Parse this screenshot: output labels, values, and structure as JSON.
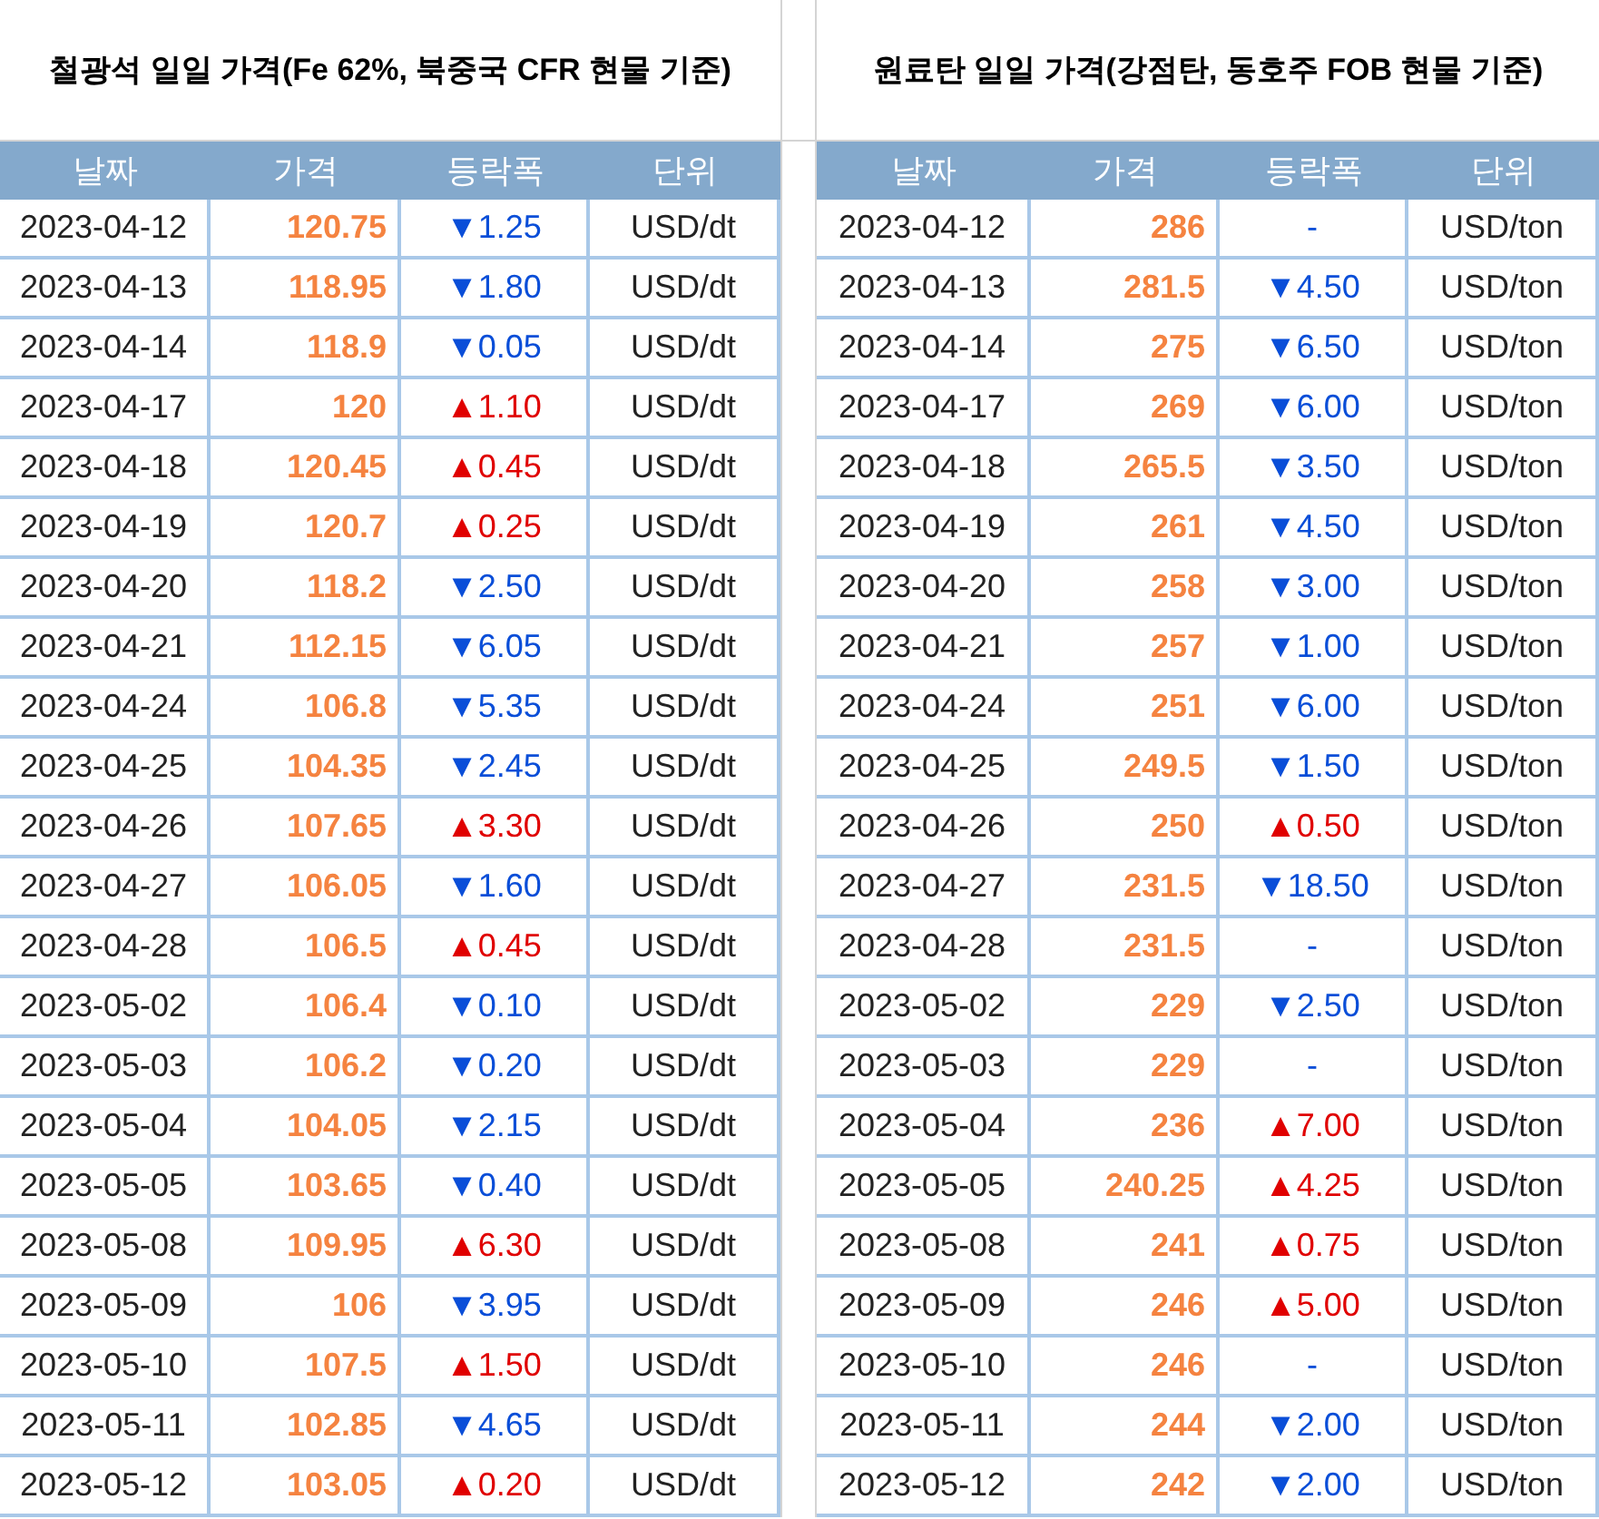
{
  "tables": [
    {
      "title": "철광석 일일 가격(Fe 62%, 북중국 CFR 현물 기준)",
      "columns": [
        "날짜",
        "가격",
        "등락폭",
        "단위"
      ],
      "rows": [
        {
          "date": "2023-04-12",
          "price": "120.75",
          "change": "▼1.25",
          "kind": "down",
          "unit": "USD/dt"
        },
        {
          "date": "2023-04-13",
          "price": "118.95",
          "change": "▼1.80",
          "kind": "down",
          "unit": "USD/dt"
        },
        {
          "date": "2023-04-14",
          "price": "118.9",
          "change": "▼0.05",
          "kind": "down",
          "unit": "USD/dt"
        },
        {
          "date": "2023-04-17",
          "price": "120",
          "change": "▲1.10",
          "kind": "up",
          "unit": "USD/dt"
        },
        {
          "date": "2023-04-18",
          "price": "120.45",
          "change": "▲0.45",
          "kind": "up",
          "unit": "USD/dt"
        },
        {
          "date": "2023-04-19",
          "price": "120.7",
          "change": "▲0.25",
          "kind": "up",
          "unit": "USD/dt"
        },
        {
          "date": "2023-04-20",
          "price": "118.2",
          "change": "▼2.50",
          "kind": "down",
          "unit": "USD/dt"
        },
        {
          "date": "2023-04-21",
          "price": "112.15",
          "change": "▼6.05",
          "kind": "down",
          "unit": "USD/dt"
        },
        {
          "date": "2023-04-24",
          "price": "106.8",
          "change": "▼5.35",
          "kind": "down",
          "unit": "USD/dt"
        },
        {
          "date": "2023-04-25",
          "price": "104.35",
          "change": "▼2.45",
          "kind": "down",
          "unit": "USD/dt"
        },
        {
          "date": "2023-04-26",
          "price": "107.65",
          "change": "▲3.30",
          "kind": "up",
          "unit": "USD/dt"
        },
        {
          "date": "2023-04-27",
          "price": "106.05",
          "change": "▼1.60",
          "kind": "down",
          "unit": "USD/dt"
        },
        {
          "date": "2023-04-28",
          "price": "106.5",
          "change": "▲0.45",
          "kind": "up",
          "unit": "USD/dt"
        },
        {
          "date": "2023-05-02",
          "price": "106.4",
          "change": "▼0.10",
          "kind": "down",
          "unit": "USD/dt"
        },
        {
          "date": "2023-05-03",
          "price": "106.2",
          "change": "▼0.20",
          "kind": "down",
          "unit": "USD/dt"
        },
        {
          "date": "2023-05-04",
          "price": "104.05",
          "change": "▼2.15",
          "kind": "down",
          "unit": "USD/dt"
        },
        {
          "date": "2023-05-05",
          "price": "103.65",
          "change": "▼0.40",
          "kind": "down",
          "unit": "USD/dt"
        },
        {
          "date": "2023-05-08",
          "price": "109.95",
          "change": "▲6.30",
          "kind": "up",
          "unit": "USD/dt"
        },
        {
          "date": "2023-05-09",
          "price": "106",
          "change": "▼3.95",
          "kind": "down",
          "unit": "USD/dt"
        },
        {
          "date": "2023-05-10",
          "price": "107.5",
          "change": "▲1.50",
          "kind": "up",
          "unit": "USD/dt"
        },
        {
          "date": "2023-05-11",
          "price": "102.85",
          "change": "▼4.65",
          "kind": "down",
          "unit": "USD/dt"
        },
        {
          "date": "2023-05-12",
          "price": "103.05",
          "change": "▲0.20",
          "kind": "up",
          "unit": "USD/dt"
        }
      ]
    },
    {
      "title": "원료탄 일일 가격(강점탄, 동호주 FOB 현물 기준)",
      "columns": [
        "날짜",
        "가격",
        "등락폭",
        "단위"
      ],
      "rows": [
        {
          "date": "2023-04-12",
          "price": "286",
          "change": "-",
          "kind": "none",
          "unit": "USD/ton"
        },
        {
          "date": "2023-04-13",
          "price": "281.5",
          "change": "▼4.50",
          "kind": "down",
          "unit": "USD/ton"
        },
        {
          "date": "2023-04-14",
          "price": "275",
          "change": "▼6.50",
          "kind": "down",
          "unit": "USD/ton"
        },
        {
          "date": "2023-04-17",
          "price": "269",
          "change": "▼6.00",
          "kind": "down",
          "unit": "USD/ton"
        },
        {
          "date": "2023-04-18",
          "price": "265.5",
          "change": "▼3.50",
          "kind": "down",
          "unit": "USD/ton"
        },
        {
          "date": "2023-04-19",
          "price": "261",
          "change": "▼4.50",
          "kind": "down",
          "unit": "USD/ton"
        },
        {
          "date": "2023-04-20",
          "price": "258",
          "change": "▼3.00",
          "kind": "down",
          "unit": "USD/ton"
        },
        {
          "date": "2023-04-21",
          "price": "257",
          "change": "▼1.00",
          "kind": "down",
          "unit": "USD/ton"
        },
        {
          "date": "2023-04-24",
          "price": "251",
          "change": "▼6.00",
          "kind": "down",
          "unit": "USD/ton"
        },
        {
          "date": "2023-04-25",
          "price": "249.5",
          "change": "▼1.50",
          "kind": "down",
          "unit": "USD/ton"
        },
        {
          "date": "2023-04-26",
          "price": "250",
          "change": "▲0.50",
          "kind": "up",
          "unit": "USD/ton"
        },
        {
          "date": "2023-04-27",
          "price": "231.5",
          "change": "▼18.50",
          "kind": "down",
          "unit": "USD/ton"
        },
        {
          "date": "2023-04-28",
          "price": "231.5",
          "change": "-",
          "kind": "none",
          "unit": "USD/ton"
        },
        {
          "date": "2023-05-02",
          "price": "229",
          "change": "▼2.50",
          "kind": "down",
          "unit": "USD/ton"
        },
        {
          "date": "2023-05-03",
          "price": "229",
          "change": "-",
          "kind": "none",
          "unit": "USD/ton"
        },
        {
          "date": "2023-05-04",
          "price": "236",
          "change": "▲7.00",
          "kind": "up",
          "unit": "USD/ton"
        },
        {
          "date": "2023-05-05",
          "price": "240.25",
          "change": "▲4.25",
          "kind": "up",
          "unit": "USD/ton"
        },
        {
          "date": "2023-05-08",
          "price": "241",
          "change": "▲0.75",
          "kind": "up",
          "unit": "USD/ton"
        },
        {
          "date": "2023-05-09",
          "price": "246",
          "change": "▲5.00",
          "kind": "up",
          "unit": "USD/ton"
        },
        {
          "date": "2023-05-10",
          "price": "246",
          "change": "-",
          "kind": "none",
          "unit": "USD/ton"
        },
        {
          "date": "2023-05-11",
          "price": "244",
          "change": "▼2.00",
          "kind": "down",
          "unit": "USD/ton"
        },
        {
          "date": "2023-05-12",
          "price": "242",
          "change": "▼2.00",
          "kind": "down",
          "unit": "USD/ton"
        }
      ]
    }
  ]
}
